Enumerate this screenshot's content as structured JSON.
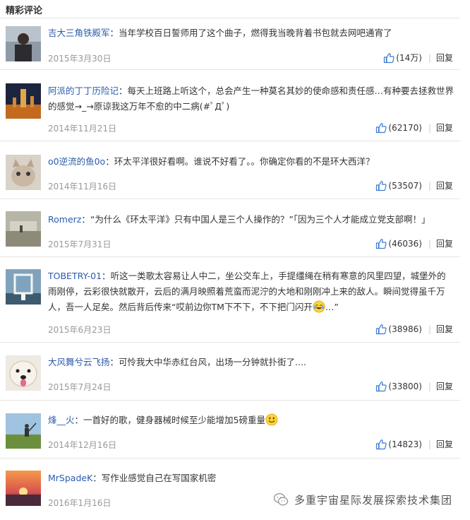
{
  "section": {
    "title": "精彩评论"
  },
  "comments": [
    {
      "user": "吉大三角铁殿军",
      "text": "当年学校百日誓师用了这个曲子，燃得我当晚背着书包就去网吧通宵了",
      "date": "2015年3月30日",
      "likes": "(14万)",
      "reply": "回复"
    },
    {
      "user": "阿派的丁丁历险记",
      "text": "每天上班路上听这个，总会产生一种莫名其妙的使命感和责任感…有种要去拯救世界的感觉→_→原谅我这万年不愈的中二病(#ﾟДﾟ)",
      "date": "2014年11月21日",
      "likes": "(62170)",
      "reply": "回复"
    },
    {
      "user": "o0逆流的鱼0o",
      "text": "环太平洋很好看啊。谁说不好看了。。你确定你看的不是环大西洋？",
      "date": "2014年11月16日",
      "likes": "(53507)",
      "reply": "回复"
    },
    {
      "user": "Romerz",
      "text": "“为什么《环太平洋》只有中国人是三个人操作的？”「因为三个人才能成立党支部啊！」",
      "date": "2015年7月31日",
      "likes": "(46036)",
      "reply": "回复"
    },
    {
      "user": "TOBETRY-01",
      "text": "听这一类歌太容易让人中二，坐公交车上，手提缰绳在稍有寒意的风里四望，城堡外的雨刚停，云彩很快就散开，云后的满月映照着荒蛮而泥泞的大地和刚刚冲上来的敌人。瞬间觉得虽千万人，吾一人足矣。然后背后传来“哎前边你TM下不下，不下把门闪开",
      "text_after": "…”",
      "date": "2015年6月23日",
      "likes": "(38986)",
      "reply": "回复"
    },
    {
      "user": "大风舞兮云飞扬",
      "text": "可怜我大中华赤红台风，出场一分钟就扑街了....",
      "date": "2015年7月24日",
      "likes": "(33800)",
      "reply": "回复"
    },
    {
      "user": "烽__火",
      "text": "一首好的歌，健身器械时候至少能增加5磅重量",
      "date": "2014年12月16日",
      "likes": "(14823)",
      "reply": "回复"
    },
    {
      "user": "MrSpadeK",
      "text": "写作业感觉自己在写国家机密",
      "date": "2016年1月16日"
    }
  ],
  "watermark": {
    "text": "多重宇宙星际发展探索技术集团"
  },
  "colors": {
    "username": "#2b5cab",
    "date": "#999999",
    "divider": "#e5e5e5",
    "thumb": "#3b7ad1"
  }
}
